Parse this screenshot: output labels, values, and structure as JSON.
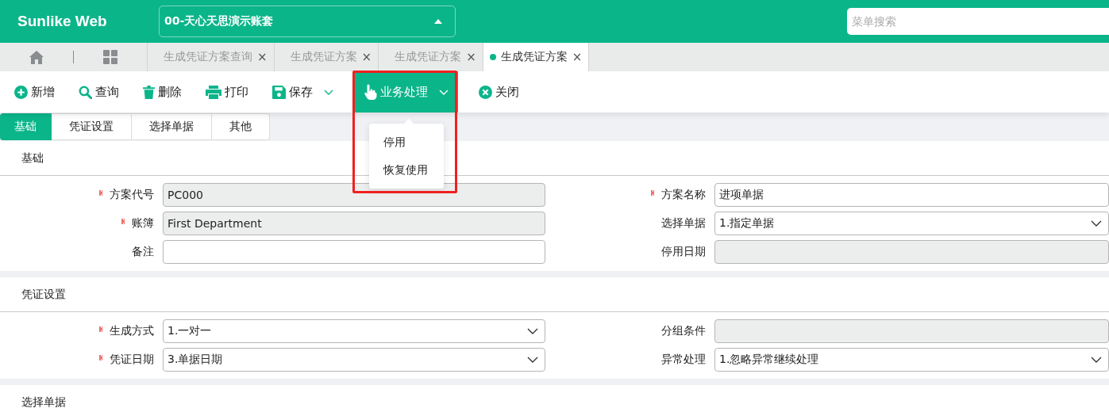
{
  "header": {
    "logo": "Sunlike Web",
    "account": "00-天心天思演示账套",
    "search": {
      "placeholder": "菜单搜索"
    }
  },
  "tabs": [
    {
      "label": "生成凭证方案查询",
      "selected": false,
      "close": "×"
    },
    {
      "label": "生成凭证方案",
      "selected": false,
      "close": "×"
    },
    {
      "label": "生成凭证方案",
      "selected": false,
      "close": "×"
    },
    {
      "label": "生成凭证方案",
      "selected": true,
      "close": "×"
    }
  ],
  "toolbar": [
    {
      "kind": "add",
      "label": "新增"
    },
    {
      "kind": "search",
      "label": "查询"
    },
    {
      "kind": "delete",
      "label": "删除"
    },
    {
      "kind": "print",
      "label": "打印"
    },
    {
      "kind": "save",
      "label": "保存",
      "caret": true,
      "open": false
    },
    {
      "kind": "process",
      "label": "业务处理",
      "caret": true,
      "open": true,
      "menu": [
        "停用",
        "恢复使用"
      ]
    },
    {
      "kind": "close",
      "label": "关闭"
    }
  ],
  "subtabs": [
    {
      "label": "基础",
      "selected": true
    },
    {
      "label": "凭证设置",
      "selected": false
    },
    {
      "label": "选择单据",
      "selected": false
    },
    {
      "label": "其他",
      "selected": false
    }
  ],
  "sections": [
    {
      "title": "基础",
      "fields": [
        {
          "label": "方案代号",
          "required": true,
          "kind": "text",
          "value": "PC000",
          "disabled": true
        },
        {
          "label": "方案名称",
          "required": true,
          "kind": "text",
          "value": "进项单据",
          "disabled": false
        },
        {
          "label": "账簿",
          "required": true,
          "kind": "text",
          "value": "First Department",
          "disabled": true
        },
        {
          "label": "选择单据",
          "required": false,
          "kind": "select",
          "value": "1.指定单据",
          "disabled": false
        },
        {
          "label": "备注",
          "required": false,
          "kind": "text",
          "disabled": false
        },
        {
          "label": "停用日期",
          "required": false,
          "kind": "text",
          "disabled": true
        }
      ]
    },
    {
      "title": "凭证设置",
      "fields": [
        {
          "label": "生成方式",
          "required": true,
          "kind": "select",
          "value": "1.一对一",
          "disabled": false
        },
        {
          "label": "分组条件",
          "required": false,
          "kind": "text",
          "disabled": true
        },
        {
          "label": "凭证日期",
          "required": true,
          "kind": "select",
          "value": "3.单据日期",
          "disabled": false
        },
        {
          "label": "异常处理",
          "required": false,
          "kind": "select",
          "value": "1.忽略异常继续处理",
          "disabled": false
        }
      ]
    },
    {
      "title": "选择单据"
    }
  ]
}
